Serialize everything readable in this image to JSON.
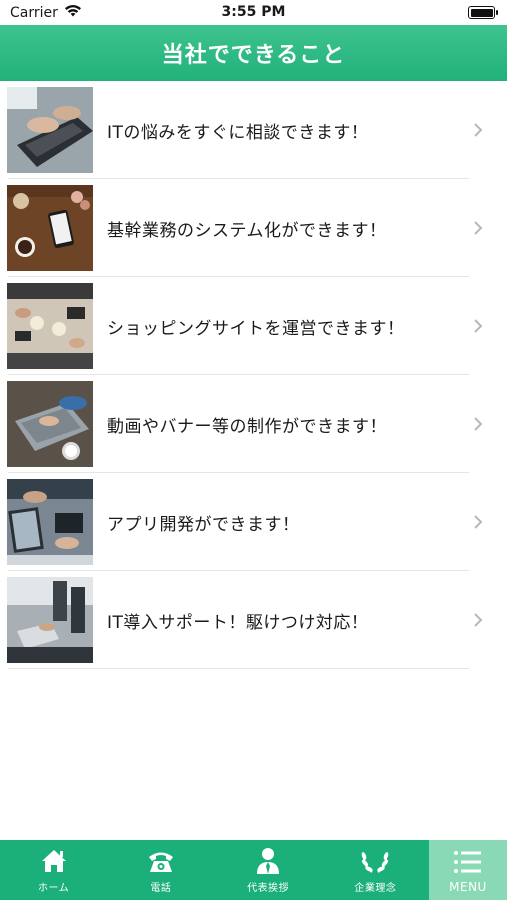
{
  "status_bar": {
    "carrier": "Carrier",
    "time": "3:55 PM"
  },
  "nav": {
    "title": "当社でできること"
  },
  "list": {
    "items": [
      {
        "label": "ITの悩みをすぐに相談できます！",
        "thumb": "laptop-typing"
      },
      {
        "label": "基幹業務のシステム化ができます！",
        "thumb": "desk-phone-coffee"
      },
      {
        "label": "ショッピングサイトを運営できます！",
        "thumb": "team-table"
      },
      {
        "label": "動画やバナー等の制作ができます！",
        "thumb": "laptop-desk"
      },
      {
        "label": "アプリ開発ができます！",
        "thumb": "hands-devices"
      },
      {
        "label": "IT導入サポート！駆けつけ対応！",
        "thumb": "office-meeting"
      }
    ]
  },
  "tab_bar": {
    "items": [
      {
        "label": "ホーム",
        "icon": "home-icon"
      },
      {
        "label": "電話",
        "icon": "phone-icon"
      },
      {
        "label": "代表挨拶",
        "icon": "person-icon"
      },
      {
        "label": "企業理念",
        "icon": "laurel-icon"
      },
      {
        "label": "MENU",
        "icon": "menu-icon"
      }
    ],
    "active_index": 4
  },
  "colors": {
    "brand_green": "#22b17a",
    "tab_active": "#8ad9b6"
  }
}
